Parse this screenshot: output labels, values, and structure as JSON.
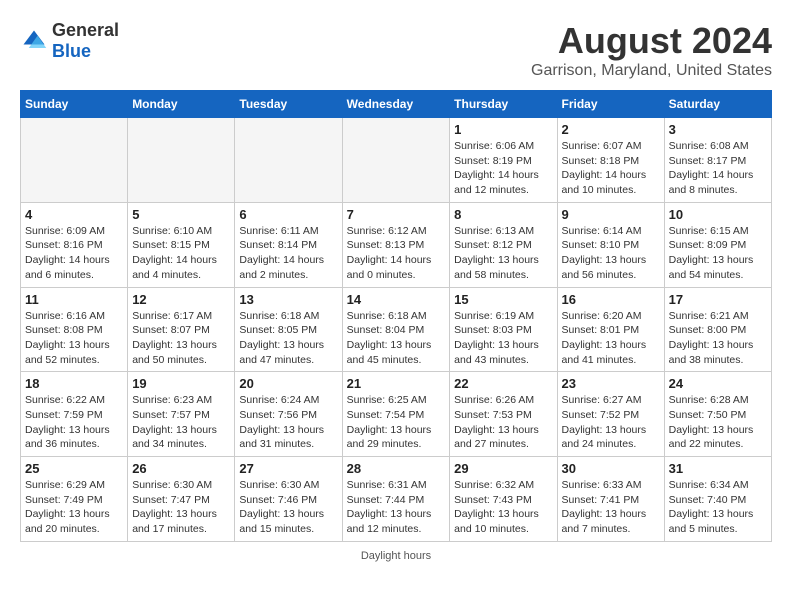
{
  "logo": {
    "general": "General",
    "blue": "Blue"
  },
  "title": {
    "month_year": "August 2024",
    "location": "Garrison, Maryland, United States"
  },
  "weekdays": [
    "Sunday",
    "Monday",
    "Tuesday",
    "Wednesday",
    "Thursday",
    "Friday",
    "Saturday"
  ],
  "footer": {
    "daylight_hours": "Daylight hours"
  },
  "weeks": [
    [
      {
        "day": "",
        "info": ""
      },
      {
        "day": "",
        "info": ""
      },
      {
        "day": "",
        "info": ""
      },
      {
        "day": "",
        "info": ""
      },
      {
        "day": "1",
        "info": "Sunrise: 6:06 AM\nSunset: 8:19 PM\nDaylight: 14 hours and 12 minutes."
      },
      {
        "day": "2",
        "info": "Sunrise: 6:07 AM\nSunset: 8:18 PM\nDaylight: 14 hours and 10 minutes."
      },
      {
        "day": "3",
        "info": "Sunrise: 6:08 AM\nSunset: 8:17 PM\nDaylight: 14 hours and 8 minutes."
      }
    ],
    [
      {
        "day": "4",
        "info": "Sunrise: 6:09 AM\nSunset: 8:16 PM\nDaylight: 14 hours and 6 minutes."
      },
      {
        "day": "5",
        "info": "Sunrise: 6:10 AM\nSunset: 8:15 PM\nDaylight: 14 hours and 4 minutes."
      },
      {
        "day": "6",
        "info": "Sunrise: 6:11 AM\nSunset: 8:14 PM\nDaylight: 14 hours and 2 minutes."
      },
      {
        "day": "7",
        "info": "Sunrise: 6:12 AM\nSunset: 8:13 PM\nDaylight: 14 hours and 0 minutes."
      },
      {
        "day": "8",
        "info": "Sunrise: 6:13 AM\nSunset: 8:12 PM\nDaylight: 13 hours and 58 minutes."
      },
      {
        "day": "9",
        "info": "Sunrise: 6:14 AM\nSunset: 8:10 PM\nDaylight: 13 hours and 56 minutes."
      },
      {
        "day": "10",
        "info": "Sunrise: 6:15 AM\nSunset: 8:09 PM\nDaylight: 13 hours and 54 minutes."
      }
    ],
    [
      {
        "day": "11",
        "info": "Sunrise: 6:16 AM\nSunset: 8:08 PM\nDaylight: 13 hours and 52 minutes."
      },
      {
        "day": "12",
        "info": "Sunrise: 6:17 AM\nSunset: 8:07 PM\nDaylight: 13 hours and 50 minutes."
      },
      {
        "day": "13",
        "info": "Sunrise: 6:18 AM\nSunset: 8:05 PM\nDaylight: 13 hours and 47 minutes."
      },
      {
        "day": "14",
        "info": "Sunrise: 6:18 AM\nSunset: 8:04 PM\nDaylight: 13 hours and 45 minutes."
      },
      {
        "day": "15",
        "info": "Sunrise: 6:19 AM\nSunset: 8:03 PM\nDaylight: 13 hours and 43 minutes."
      },
      {
        "day": "16",
        "info": "Sunrise: 6:20 AM\nSunset: 8:01 PM\nDaylight: 13 hours and 41 minutes."
      },
      {
        "day": "17",
        "info": "Sunrise: 6:21 AM\nSunset: 8:00 PM\nDaylight: 13 hours and 38 minutes."
      }
    ],
    [
      {
        "day": "18",
        "info": "Sunrise: 6:22 AM\nSunset: 7:59 PM\nDaylight: 13 hours and 36 minutes."
      },
      {
        "day": "19",
        "info": "Sunrise: 6:23 AM\nSunset: 7:57 PM\nDaylight: 13 hours and 34 minutes."
      },
      {
        "day": "20",
        "info": "Sunrise: 6:24 AM\nSunset: 7:56 PM\nDaylight: 13 hours and 31 minutes."
      },
      {
        "day": "21",
        "info": "Sunrise: 6:25 AM\nSunset: 7:54 PM\nDaylight: 13 hours and 29 minutes."
      },
      {
        "day": "22",
        "info": "Sunrise: 6:26 AM\nSunset: 7:53 PM\nDaylight: 13 hours and 27 minutes."
      },
      {
        "day": "23",
        "info": "Sunrise: 6:27 AM\nSunset: 7:52 PM\nDaylight: 13 hours and 24 minutes."
      },
      {
        "day": "24",
        "info": "Sunrise: 6:28 AM\nSunset: 7:50 PM\nDaylight: 13 hours and 22 minutes."
      }
    ],
    [
      {
        "day": "25",
        "info": "Sunrise: 6:29 AM\nSunset: 7:49 PM\nDaylight: 13 hours and 20 minutes."
      },
      {
        "day": "26",
        "info": "Sunrise: 6:30 AM\nSunset: 7:47 PM\nDaylight: 13 hours and 17 minutes."
      },
      {
        "day": "27",
        "info": "Sunrise: 6:30 AM\nSunset: 7:46 PM\nDaylight: 13 hours and 15 minutes."
      },
      {
        "day": "28",
        "info": "Sunrise: 6:31 AM\nSunset: 7:44 PM\nDaylight: 13 hours and 12 minutes."
      },
      {
        "day": "29",
        "info": "Sunrise: 6:32 AM\nSunset: 7:43 PM\nDaylight: 13 hours and 10 minutes."
      },
      {
        "day": "30",
        "info": "Sunrise: 6:33 AM\nSunset: 7:41 PM\nDaylight: 13 hours and 7 minutes."
      },
      {
        "day": "31",
        "info": "Sunrise: 6:34 AM\nSunset: 7:40 PM\nDaylight: 13 hours and 5 minutes."
      }
    ]
  ]
}
